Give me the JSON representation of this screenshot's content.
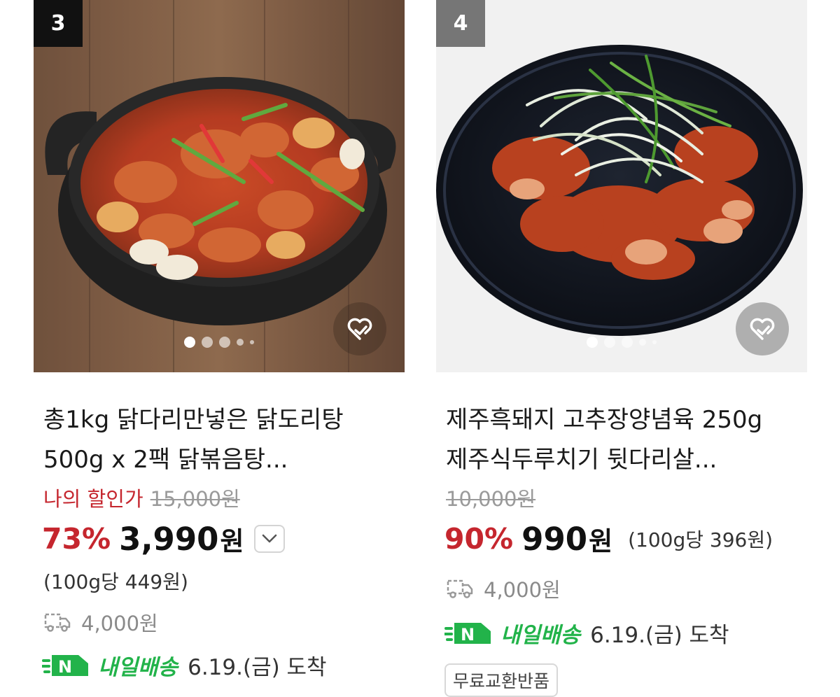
{
  "products": [
    {
      "rank": "3",
      "title_lines": [
        "총1kg 닭다리만넣은 닭도리탕",
        "500g x 2팩 닭볶음탕..."
      ],
      "my_discount_label": "나의 할인가",
      "original_price": "15,000원",
      "discount_rate": "73%",
      "price": "3,990",
      "currency": "원",
      "unit_price": "(100g당 449원)",
      "shipping_fee": "4,000원",
      "delivery_label": "내일배송",
      "delivery_date": "6.19.(금) 도착",
      "image_dots": 5,
      "active_dot": 0
    },
    {
      "rank": "4",
      "title_lines": [
        "제주흑돼지 고추장양념육 250g",
        "제주식두루치기 뒷다리살..."
      ],
      "original_price": "10,000원",
      "discount_rate": "90%",
      "price": "990",
      "currency": "원",
      "unit_price": "(100g당 396원)",
      "shipping_fee": "4,000원",
      "delivery_label": "내일배송",
      "delivery_date": "6.19.(금) 도착",
      "tag": "무료교환반품",
      "image_dots": 5,
      "active_dot": 0
    }
  ],
  "icons": {
    "rank_badge": "rank-badge",
    "wish": "heart-check-icon",
    "more": "chevron-down-icon",
    "shipping": "truck-icon",
    "delivery": "n-delivery-badge-icon"
  },
  "colors": {
    "discount_red": "#c5262e",
    "delivery_green": "#22b34a",
    "muted_gray": "#9a9a9a"
  }
}
